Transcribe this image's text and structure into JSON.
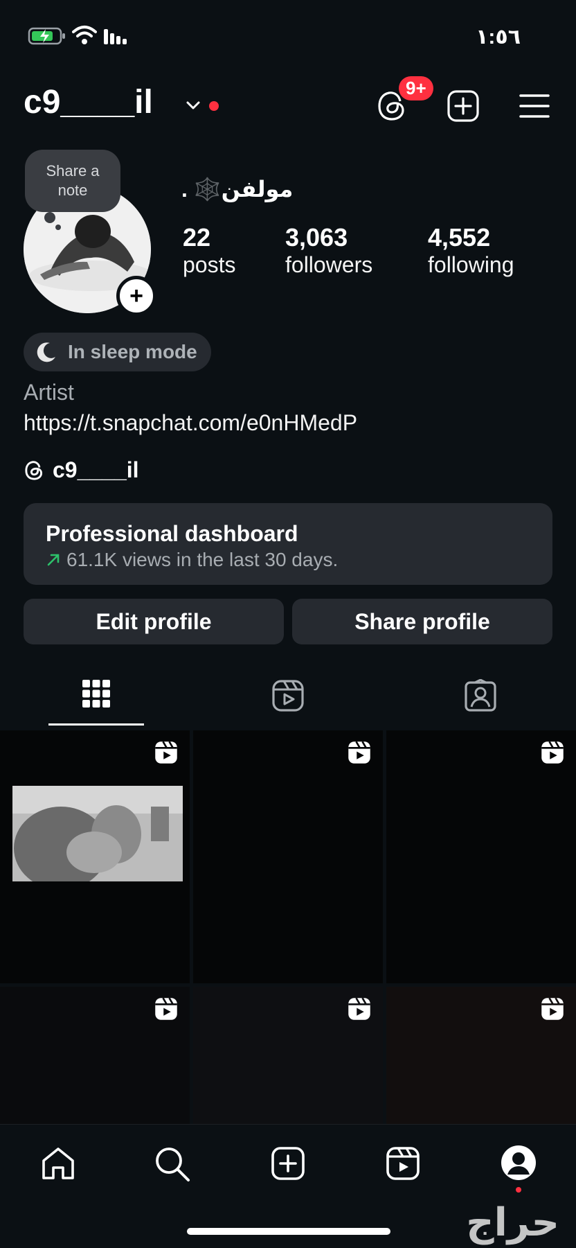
{
  "status_bar": {
    "time": "١:٥٦"
  },
  "header": {
    "username": "c9____il",
    "notification_badge": "9+"
  },
  "profile": {
    "note_prompt": "Share a note",
    "display_name": "مولفن🕸️ .",
    "stats": [
      {
        "value": "22",
        "label": "posts"
      },
      {
        "value": "3,063",
        "label": "followers"
      },
      {
        "value": "4,552",
        "label": "following"
      }
    ],
    "status_pill": "In sleep mode",
    "category": "Artist",
    "link": "https://t.snapchat.com/e0nHMedP",
    "threads_handle": "c9____il"
  },
  "dashboard": {
    "title": "Professional dashboard",
    "subtitle": "61.1K views in the last 30 days.",
    "trend_color": "#2dc26b"
  },
  "buttons": {
    "edit": "Edit profile",
    "share": "Share profile"
  },
  "tabs": [
    "grid-icon",
    "reels-icon",
    "tagged-icon"
  ],
  "watermark": "حراج",
  "colors": {
    "background": "#0b1014",
    "surface": "#262a30",
    "accent_red": "#ff3040"
  }
}
